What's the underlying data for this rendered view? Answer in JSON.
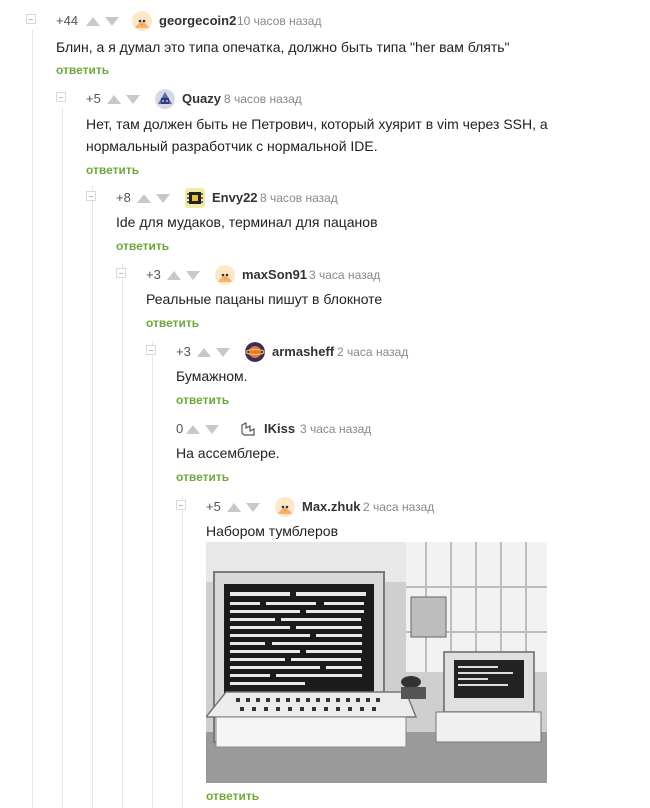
{
  "colors": {
    "reply": "#6ea83c",
    "rating": "#555555",
    "meta": "#888888",
    "thread_line": "#e6e6e6"
  },
  "comments": [
    {
      "rating": "+44",
      "author": "georgecoin2",
      "time": "10 часов назад",
      "avatar_icon": "chick-avatar-icon",
      "text": "Блин, а я думал это типа опечатка, должно быть типа \"her вам блять\"",
      "reply": "ответить"
    },
    {
      "rating": "+5",
      "author": "Quazy",
      "time": "8 часов назад",
      "avatar_icon": "robot-avatar-icon",
      "text": "Нет, там должен быть не Петрович, который хуярит в vim через SSH, а нормальный разработчик с нормальной IDE.",
      "reply": "ответить"
    },
    {
      "rating": "+8",
      "author": "Envy22",
      "time": "8 часов назад",
      "avatar_icon": "chip-avatar-icon",
      "text": "Ide для мудаков, терминал для пацанов",
      "reply": "ответить"
    },
    {
      "rating": "+3",
      "author": "maxSon91",
      "time": "3 часа назад",
      "avatar_icon": "chick-avatar-icon",
      "text": "Реальные пацаны пишут в блокноте",
      "reply": "ответить"
    },
    {
      "rating": "+3",
      "author": "armasheff",
      "time": "2 часа назад",
      "avatar_icon": "planet-avatar-icon",
      "text": "Бумажном.",
      "reply": "ответить"
    },
    {
      "rating": "0",
      "author": "IKiss",
      "time": "3 часа назад",
      "avatar_icon": "sketch-avatar-icon",
      "text": "На ассемблере.",
      "reply": "ответить"
    },
    {
      "rating": "+5",
      "author": "Max.zhuk",
      "time": "2 часа назад",
      "avatar_icon": "chick-avatar-icon",
      "text": "Набором тумблеров",
      "reply": "ответить",
      "image": "vintage-computer-console-photo"
    }
  ]
}
